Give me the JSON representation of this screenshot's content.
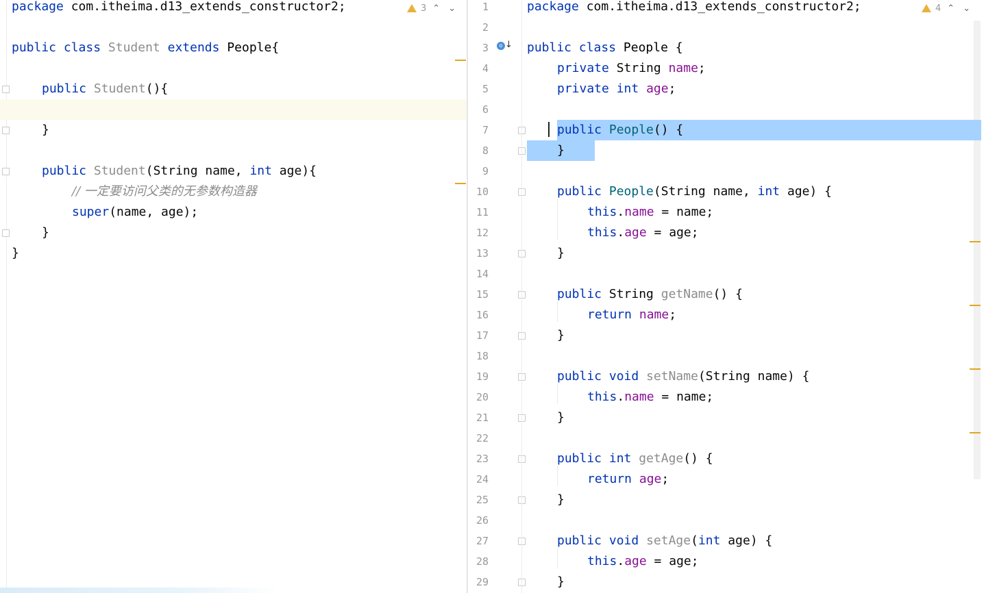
{
  "left_editor": {
    "warnings": {
      "count": "3"
    },
    "nav": {
      "up": "⌃",
      "down": "⌄"
    },
    "lines": {
      "l1": {
        "kw": "package",
        "text": " com.itheima.d13_extends_constructor2;"
      },
      "l3": {
        "kw1": "public",
        "kw2": "class",
        "name": "Student",
        "kw3": "extends",
        "parent": "People{"
      },
      "l5": {
        "kw": "public",
        "name": "Student",
        "rest": "(){"
      },
      "l7": {
        "text": "}"
      },
      "l9": {
        "kw": "public",
        "name": "Student",
        "p1": "(String name, ",
        "kw2": "int",
        "p2": " age){"
      },
      "l10": {
        "comment": "// 一定要访问父类的无参数构造器"
      },
      "l11": {
        "kw": "super",
        "rest": "(name, age);"
      },
      "l12": {
        "text": "}"
      },
      "l13": {
        "text": "}"
      }
    }
  },
  "right_editor": {
    "warnings": {
      "count": "4"
    },
    "nav": {
      "up": "⌃",
      "down": "⌄"
    },
    "line_numbers": [
      "1",
      "2",
      "3",
      "4",
      "5",
      "6",
      "7",
      "8",
      "9",
      "10",
      "11",
      "12",
      "13",
      "14",
      "15",
      "16",
      "17",
      "18",
      "19",
      "20",
      "21",
      "22",
      "23",
      "24",
      "25",
      "26",
      "27",
      "28",
      "29"
    ],
    "gutter_icon": "o",
    "lines": {
      "l1": {
        "kw": "package",
        "text": " com.itheima.d13_extends_constructor2;"
      },
      "l3": {
        "kw1": "public",
        "kw2": "class",
        "name": "People {"
      },
      "l4": {
        "kw": "private",
        "type": " String ",
        "field": "name",
        "end": ";"
      },
      "l5": {
        "kw": "private",
        "type": "int",
        "field": "age",
        "end": ";"
      },
      "l7": {
        "kw": "public",
        "name": "People",
        "rest": "() {"
      },
      "l8": {
        "text": "}"
      },
      "l10": {
        "kw": "public",
        "name": "People",
        "p1": "(String name, ",
        "kw2": "int",
        "p2": " age) {"
      },
      "l11": {
        "kw": "this",
        "dot": ".",
        "field": "name",
        "rest": " = name;"
      },
      "l12": {
        "kw": "this",
        "dot": ".",
        "field": "age",
        "rest": " = age;"
      },
      "l13": {
        "text": "}"
      },
      "l15": {
        "kw": "public",
        "type": " String ",
        "name": "getName",
        "rest": "() {"
      },
      "l16": {
        "kw": "return",
        "field": "name",
        "end": ";"
      },
      "l17": {
        "text": "}"
      },
      "l19": {
        "kw": "public",
        "kw2": "void",
        "name": "setName",
        "rest": "(String name) {"
      },
      "l20": {
        "kw": "this",
        "dot": ".",
        "field": "name",
        "rest": " = name;"
      },
      "l21": {
        "text": "}"
      },
      "l23": {
        "kw": "public",
        "kw2": "int",
        "name": "getAge",
        "rest": "() {"
      },
      "l24": {
        "kw": "return",
        "field": "age",
        "end": ";"
      },
      "l25": {
        "text": "}"
      },
      "l27": {
        "kw": "public",
        "kw2": "void",
        "name": "setAge",
        "p1": "(",
        "kw3": "int",
        "p2": " age) {"
      },
      "l28": {
        "kw": "this",
        "dot": ".",
        "field": "age",
        "rest": " = age;"
      },
      "l29": {
        "text": "}"
      }
    }
  },
  "colors": {
    "keyword": "#0033b3",
    "method": "#00627a",
    "field": "#871094",
    "comment": "#8c8c8c",
    "selection": "#a6d2ff",
    "warning": "#e8b33a"
  }
}
